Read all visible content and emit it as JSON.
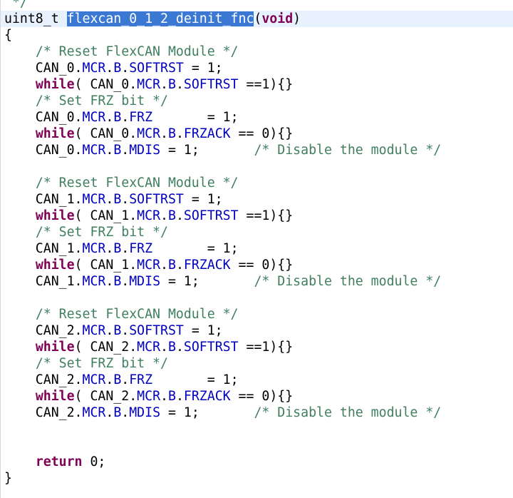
{
  "editor": {
    "current_line": 1,
    "lines": [
      {
        "tokens": [
          {
            "t": "comment",
            "v": " */"
          }
        ]
      },
      {
        "tokens": [
          {
            "t": "plain",
            "v": "uint8_t "
          },
          {
            "t": "sel",
            "v": "flexcan_0_1_2_deinit_fnc"
          },
          {
            "t": "plain",
            "v": "("
          },
          {
            "t": "kw",
            "v": "void"
          },
          {
            "t": "plain",
            "v": ")"
          }
        ]
      },
      {
        "tokens": [
          {
            "t": "plain",
            "v": "{"
          }
        ]
      },
      {
        "tokens": [
          {
            "t": "plain",
            "v": "    "
          },
          {
            "t": "comment",
            "v": "/* Reset FlexCAN Module */"
          }
        ]
      },
      {
        "tokens": [
          {
            "t": "plain",
            "v": "    CAN_0."
          },
          {
            "t": "field",
            "v": "MCR"
          },
          {
            "t": "plain",
            "v": "."
          },
          {
            "t": "field",
            "v": "B"
          },
          {
            "t": "plain",
            "v": "."
          },
          {
            "t": "field",
            "v": "SOFTRST"
          },
          {
            "t": "plain",
            "v": " = 1;"
          }
        ]
      },
      {
        "tokens": [
          {
            "t": "plain",
            "v": "    "
          },
          {
            "t": "kw",
            "v": "while"
          },
          {
            "t": "plain",
            "v": "( CAN_0."
          },
          {
            "t": "field",
            "v": "MCR"
          },
          {
            "t": "plain",
            "v": "."
          },
          {
            "t": "field",
            "v": "B"
          },
          {
            "t": "plain",
            "v": "."
          },
          {
            "t": "field",
            "v": "SOFTRST"
          },
          {
            "t": "plain",
            "v": " ==1){}"
          }
        ]
      },
      {
        "tokens": [
          {
            "t": "plain",
            "v": "    "
          },
          {
            "t": "comment",
            "v": "/* Set FRZ bit */"
          }
        ]
      },
      {
        "tokens": [
          {
            "t": "plain",
            "v": "    CAN_0."
          },
          {
            "t": "field",
            "v": "MCR"
          },
          {
            "t": "plain",
            "v": "."
          },
          {
            "t": "field",
            "v": "B"
          },
          {
            "t": "plain",
            "v": "."
          },
          {
            "t": "field",
            "v": "FRZ"
          },
          {
            "t": "plain",
            "v": "       = 1;"
          }
        ]
      },
      {
        "tokens": [
          {
            "t": "plain",
            "v": "    "
          },
          {
            "t": "kw",
            "v": "while"
          },
          {
            "t": "plain",
            "v": "( CAN_0."
          },
          {
            "t": "field",
            "v": "MCR"
          },
          {
            "t": "plain",
            "v": "."
          },
          {
            "t": "field",
            "v": "B"
          },
          {
            "t": "plain",
            "v": "."
          },
          {
            "t": "field",
            "v": "FRZACK"
          },
          {
            "t": "plain",
            "v": " == 0){}"
          }
        ]
      },
      {
        "tokens": [
          {
            "t": "plain",
            "v": "    CAN_0."
          },
          {
            "t": "field",
            "v": "MCR"
          },
          {
            "t": "plain",
            "v": "."
          },
          {
            "t": "field",
            "v": "B"
          },
          {
            "t": "plain",
            "v": "."
          },
          {
            "t": "field",
            "v": "MDIS"
          },
          {
            "t": "plain",
            "v": " = 1;       "
          },
          {
            "t": "comment",
            "v": "/* Disable the module */"
          }
        ]
      },
      {
        "tokens": []
      },
      {
        "tokens": [
          {
            "t": "plain",
            "v": "    "
          },
          {
            "t": "comment",
            "v": "/* Reset FlexCAN Module */"
          }
        ]
      },
      {
        "tokens": [
          {
            "t": "plain",
            "v": "    CAN_1."
          },
          {
            "t": "field",
            "v": "MCR"
          },
          {
            "t": "plain",
            "v": "."
          },
          {
            "t": "field",
            "v": "B"
          },
          {
            "t": "plain",
            "v": "."
          },
          {
            "t": "field",
            "v": "SOFTRST"
          },
          {
            "t": "plain",
            "v": " = 1;"
          }
        ]
      },
      {
        "tokens": [
          {
            "t": "plain",
            "v": "    "
          },
          {
            "t": "kw",
            "v": "while"
          },
          {
            "t": "plain",
            "v": "( CAN_1."
          },
          {
            "t": "field",
            "v": "MCR"
          },
          {
            "t": "plain",
            "v": "."
          },
          {
            "t": "field",
            "v": "B"
          },
          {
            "t": "plain",
            "v": "."
          },
          {
            "t": "field",
            "v": "SOFTRST"
          },
          {
            "t": "plain",
            "v": " ==1){}"
          }
        ]
      },
      {
        "tokens": [
          {
            "t": "plain",
            "v": "    "
          },
          {
            "t": "comment",
            "v": "/* Set FRZ bit */"
          }
        ]
      },
      {
        "tokens": [
          {
            "t": "plain",
            "v": "    CAN_1."
          },
          {
            "t": "field",
            "v": "MCR"
          },
          {
            "t": "plain",
            "v": "."
          },
          {
            "t": "field",
            "v": "B"
          },
          {
            "t": "plain",
            "v": "."
          },
          {
            "t": "field",
            "v": "FRZ"
          },
          {
            "t": "plain",
            "v": "       = 1;"
          }
        ]
      },
      {
        "tokens": [
          {
            "t": "plain",
            "v": "    "
          },
          {
            "t": "kw",
            "v": "while"
          },
          {
            "t": "plain",
            "v": "( CAN_1."
          },
          {
            "t": "field",
            "v": "MCR"
          },
          {
            "t": "plain",
            "v": "."
          },
          {
            "t": "field",
            "v": "B"
          },
          {
            "t": "plain",
            "v": "."
          },
          {
            "t": "field",
            "v": "FRZACK"
          },
          {
            "t": "plain",
            "v": " == 0){}"
          }
        ]
      },
      {
        "tokens": [
          {
            "t": "plain",
            "v": "    CAN_1."
          },
          {
            "t": "field",
            "v": "MCR"
          },
          {
            "t": "plain",
            "v": "."
          },
          {
            "t": "field",
            "v": "B"
          },
          {
            "t": "plain",
            "v": "."
          },
          {
            "t": "field",
            "v": "MDIS"
          },
          {
            "t": "plain",
            "v": " = 1;       "
          },
          {
            "t": "comment",
            "v": "/* Disable the module */"
          }
        ]
      },
      {
        "tokens": []
      },
      {
        "tokens": [
          {
            "t": "plain",
            "v": "    "
          },
          {
            "t": "comment",
            "v": "/* Reset FlexCAN Module */"
          }
        ]
      },
      {
        "tokens": [
          {
            "t": "plain",
            "v": "    CAN_2."
          },
          {
            "t": "field",
            "v": "MCR"
          },
          {
            "t": "plain",
            "v": "."
          },
          {
            "t": "field",
            "v": "B"
          },
          {
            "t": "plain",
            "v": "."
          },
          {
            "t": "field",
            "v": "SOFTRST"
          },
          {
            "t": "plain",
            "v": " = 1;"
          }
        ]
      },
      {
        "tokens": [
          {
            "t": "plain",
            "v": "    "
          },
          {
            "t": "kw",
            "v": "while"
          },
          {
            "t": "plain",
            "v": "( CAN_2."
          },
          {
            "t": "field",
            "v": "MCR"
          },
          {
            "t": "plain",
            "v": "."
          },
          {
            "t": "field",
            "v": "B"
          },
          {
            "t": "plain",
            "v": "."
          },
          {
            "t": "field",
            "v": "SOFTRST"
          },
          {
            "t": "plain",
            "v": " ==1){}"
          }
        ]
      },
      {
        "tokens": [
          {
            "t": "plain",
            "v": "    "
          },
          {
            "t": "comment",
            "v": "/* Set FRZ bit */"
          }
        ]
      },
      {
        "tokens": [
          {
            "t": "plain",
            "v": "    CAN_2."
          },
          {
            "t": "field",
            "v": "MCR"
          },
          {
            "t": "plain",
            "v": "."
          },
          {
            "t": "field",
            "v": "B"
          },
          {
            "t": "plain",
            "v": "."
          },
          {
            "t": "field",
            "v": "FRZ"
          },
          {
            "t": "plain",
            "v": "       = 1;"
          }
        ]
      },
      {
        "tokens": [
          {
            "t": "plain",
            "v": "    "
          },
          {
            "t": "kw",
            "v": "while"
          },
          {
            "t": "plain",
            "v": "( CAN_2."
          },
          {
            "t": "field",
            "v": "MCR"
          },
          {
            "t": "plain",
            "v": "."
          },
          {
            "t": "field",
            "v": "B"
          },
          {
            "t": "plain",
            "v": "."
          },
          {
            "t": "field",
            "v": "FRZACK"
          },
          {
            "t": "plain",
            "v": " == 0){}"
          }
        ]
      },
      {
        "tokens": [
          {
            "t": "plain",
            "v": "    CAN_2."
          },
          {
            "t": "field",
            "v": "MCR"
          },
          {
            "t": "plain",
            "v": "."
          },
          {
            "t": "field",
            "v": "B"
          },
          {
            "t": "plain",
            "v": "."
          },
          {
            "t": "field",
            "v": "MDIS"
          },
          {
            "t": "plain",
            "v": " = 1;       "
          },
          {
            "t": "comment",
            "v": "/* Disable the module */"
          }
        ]
      },
      {
        "tokens": []
      },
      {
        "tokens": []
      },
      {
        "tokens": [
          {
            "t": "plain",
            "v": "    "
          },
          {
            "t": "kw",
            "v": "return"
          },
          {
            "t": "plain",
            "v": " 0;"
          }
        ]
      },
      {
        "tokens": [
          {
            "t": "plain",
            "v": "}"
          }
        ]
      }
    ]
  }
}
